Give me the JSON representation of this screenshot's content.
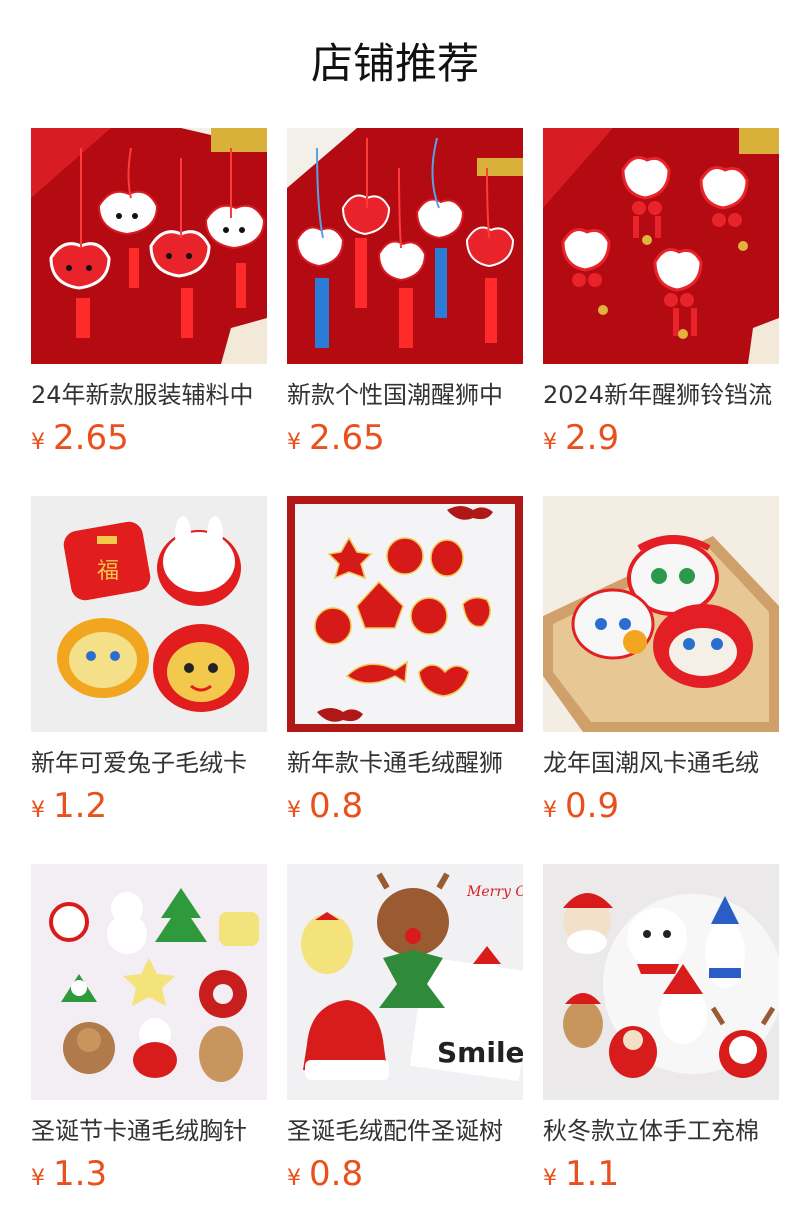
{
  "header": {
    "title": "店铺推荐"
  },
  "products": [
    {
      "name": "24年新款服装辅料中",
      "currency": "¥",
      "price": "2.65",
      "image": "red-lion-keychains",
      "bg": "#b40a12",
      "accent": "#e8232a"
    },
    {
      "name": "新款个性国潮醒狮中",
      "currency": "¥",
      "price": "2.65",
      "image": "lion-pendants-tassels",
      "bg": "#b40a12",
      "accent": "#e8232a"
    },
    {
      "name": "2024新年醒狮铃铛流",
      "currency": "¥",
      "price": "2.9",
      "image": "white-lion-bells",
      "bg": "#b40a12",
      "accent": "#e8232a"
    },
    {
      "name": "新年可爱兔子毛绒卡",
      "currency": "¥",
      "price": "1.2",
      "image": "plush-patches-white-bg",
      "bg": "#eeeeee",
      "accent": "#e11d1d"
    },
    {
      "name": "新年款卡通毛绒醒狮",
      "currency": "¥",
      "price": "0.8",
      "image": "red-felt-patches-framed",
      "bg": "#f4f4f6",
      "accent": "#d61a1a"
    },
    {
      "name": "龙年国潮风卡通毛绒",
      "currency": "¥",
      "price": "0.9",
      "image": "lion-heads-wood-tray",
      "bg": "#f3ede4",
      "accent": "#e31e24"
    },
    {
      "name": "圣诞节卡通毛绒胸针",
      "currency": "¥",
      "price": "1.3",
      "image": "christmas-plush-grid",
      "bg": "#f2eef4",
      "accent": "#d81c1c"
    },
    {
      "name": "圣诞毛绒配件圣诞树",
      "currency": "¥",
      "price": "0.8",
      "image": "christmas-plush-card",
      "bg": "#f1f1f3",
      "accent": "#d81c1c"
    },
    {
      "name": "秋冬款立体手工充棉",
      "currency": "¥",
      "price": "1.1",
      "image": "winter-plush-santa-snowman",
      "bg": "#ece9ea",
      "accent": "#d81c1c"
    }
  ],
  "decor_text": {
    "merry_christmas": "Merry Christmas",
    "smile": "Smile"
  }
}
